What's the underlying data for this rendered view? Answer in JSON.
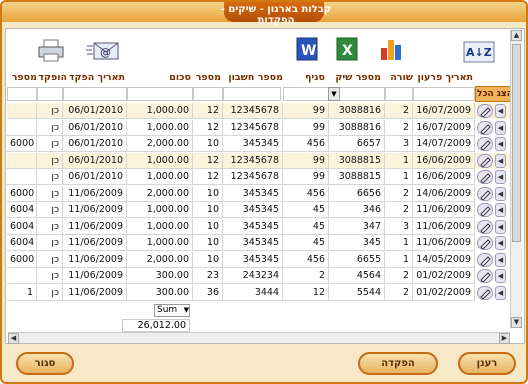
{
  "window": {
    "title": "קבלות בארגון - שיקים - הפקדות"
  },
  "toolbar": {
    "icons": [
      "printer-icon",
      "email-icon",
      "word-icon",
      "excel-icon",
      "chart-icon",
      "sort-az-icon"
    ],
    "sort_label": "A↓Z"
  },
  "grid": {
    "columns": [
      "תאריך פרעון",
      "שורה",
      "מספר שיק",
      "סניף",
      "מספר חשבון",
      "מספר",
      "סכום",
      "תאריך הפקד",
      "הופקד",
      "מספר"
    ],
    "select_all": "הצג הכל",
    "rows": [
      {
        "date": "16/07/2009",
        "line": "2",
        "check": "3088816",
        "branch": "99",
        "account": "12345678",
        "num": "12",
        "amount": "1,000.00",
        "dep_date": "06/01/2010",
        "deposited": "כן",
        "dep_num": ""
      },
      {
        "date": "16/07/2009",
        "line": "2",
        "check": "3088816",
        "branch": "99",
        "account": "12345678",
        "num": "12",
        "amount": "1,000.00",
        "dep_date": "06/01/2010",
        "deposited": "כן",
        "dep_num": ""
      },
      {
        "date": "14/07/2009",
        "line": "3",
        "check": "6657",
        "branch": "456",
        "account": "345345",
        "num": "10",
        "amount": "2,000.00",
        "dep_date": "06/01/2010",
        "deposited": "כן",
        "dep_num": "6000"
      },
      {
        "date": "16/06/2009",
        "line": "1",
        "check": "3088815",
        "branch": "99",
        "account": "12345678",
        "num": "12",
        "amount": "1,000.00",
        "dep_date": "06/01/2010",
        "deposited": "כן",
        "dep_num": ""
      },
      {
        "date": "16/06/2009",
        "line": "1",
        "check": "3088815",
        "branch": "99",
        "account": "12345678",
        "num": "12",
        "amount": "1,000.00",
        "dep_date": "06/01/2010",
        "deposited": "כן",
        "dep_num": ""
      },
      {
        "date": "14/06/2009",
        "line": "2",
        "check": "6656",
        "branch": "456",
        "account": "345345",
        "num": "10",
        "amount": "2,000.00",
        "dep_date": "11/06/2009",
        "deposited": "כן",
        "dep_num": "6000"
      },
      {
        "date": "11/06/2009",
        "line": "2",
        "check": "346",
        "branch": "45",
        "account": "345345",
        "num": "10",
        "amount": "1,000.00",
        "dep_date": "11/06/2009",
        "deposited": "כן",
        "dep_num": "6004"
      },
      {
        "date": "11/06/2009",
        "line": "3",
        "check": "347",
        "branch": "45",
        "account": "345345",
        "num": "10",
        "amount": "1,000.00",
        "dep_date": "11/06/2009",
        "deposited": "כן",
        "dep_num": "6004"
      },
      {
        "date": "11/06/2009",
        "line": "1",
        "check": "345",
        "branch": "45",
        "account": "345345",
        "num": "10",
        "amount": "1,000.00",
        "dep_date": "11/06/2009",
        "deposited": "כן",
        "dep_num": "6004"
      },
      {
        "date": "14/05/2009",
        "line": "1",
        "check": "6655",
        "branch": "456",
        "account": "345345",
        "num": "10",
        "amount": "2,000.00",
        "dep_date": "11/06/2009",
        "deposited": "כן",
        "dep_num": "6000"
      },
      {
        "date": "01/02/2009",
        "line": "2",
        "check": "4564",
        "branch": "2",
        "account": "243234",
        "num": "23",
        "amount": "300.00",
        "dep_date": "11/06/2009",
        "deposited": "כן",
        "dep_num": ""
      },
      {
        "date": "01/02/2009",
        "line": "2",
        "check": "5544",
        "branch": "12",
        "account": "3444",
        "num": "36",
        "amount": "300.00",
        "dep_date": "11/06/2009",
        "deposited": "כן",
        "dep_num": "1"
      }
    ],
    "sum_label": "Sum",
    "sum_value": "26,012.00"
  },
  "buttons": {
    "refresh": "רענן",
    "deposit": "הפקדה",
    "close": "סגור"
  },
  "colors": {
    "accent": "#d07a10",
    "header_text": "#7a2f00",
    "highlight_row": "#fbf3dc"
  }
}
